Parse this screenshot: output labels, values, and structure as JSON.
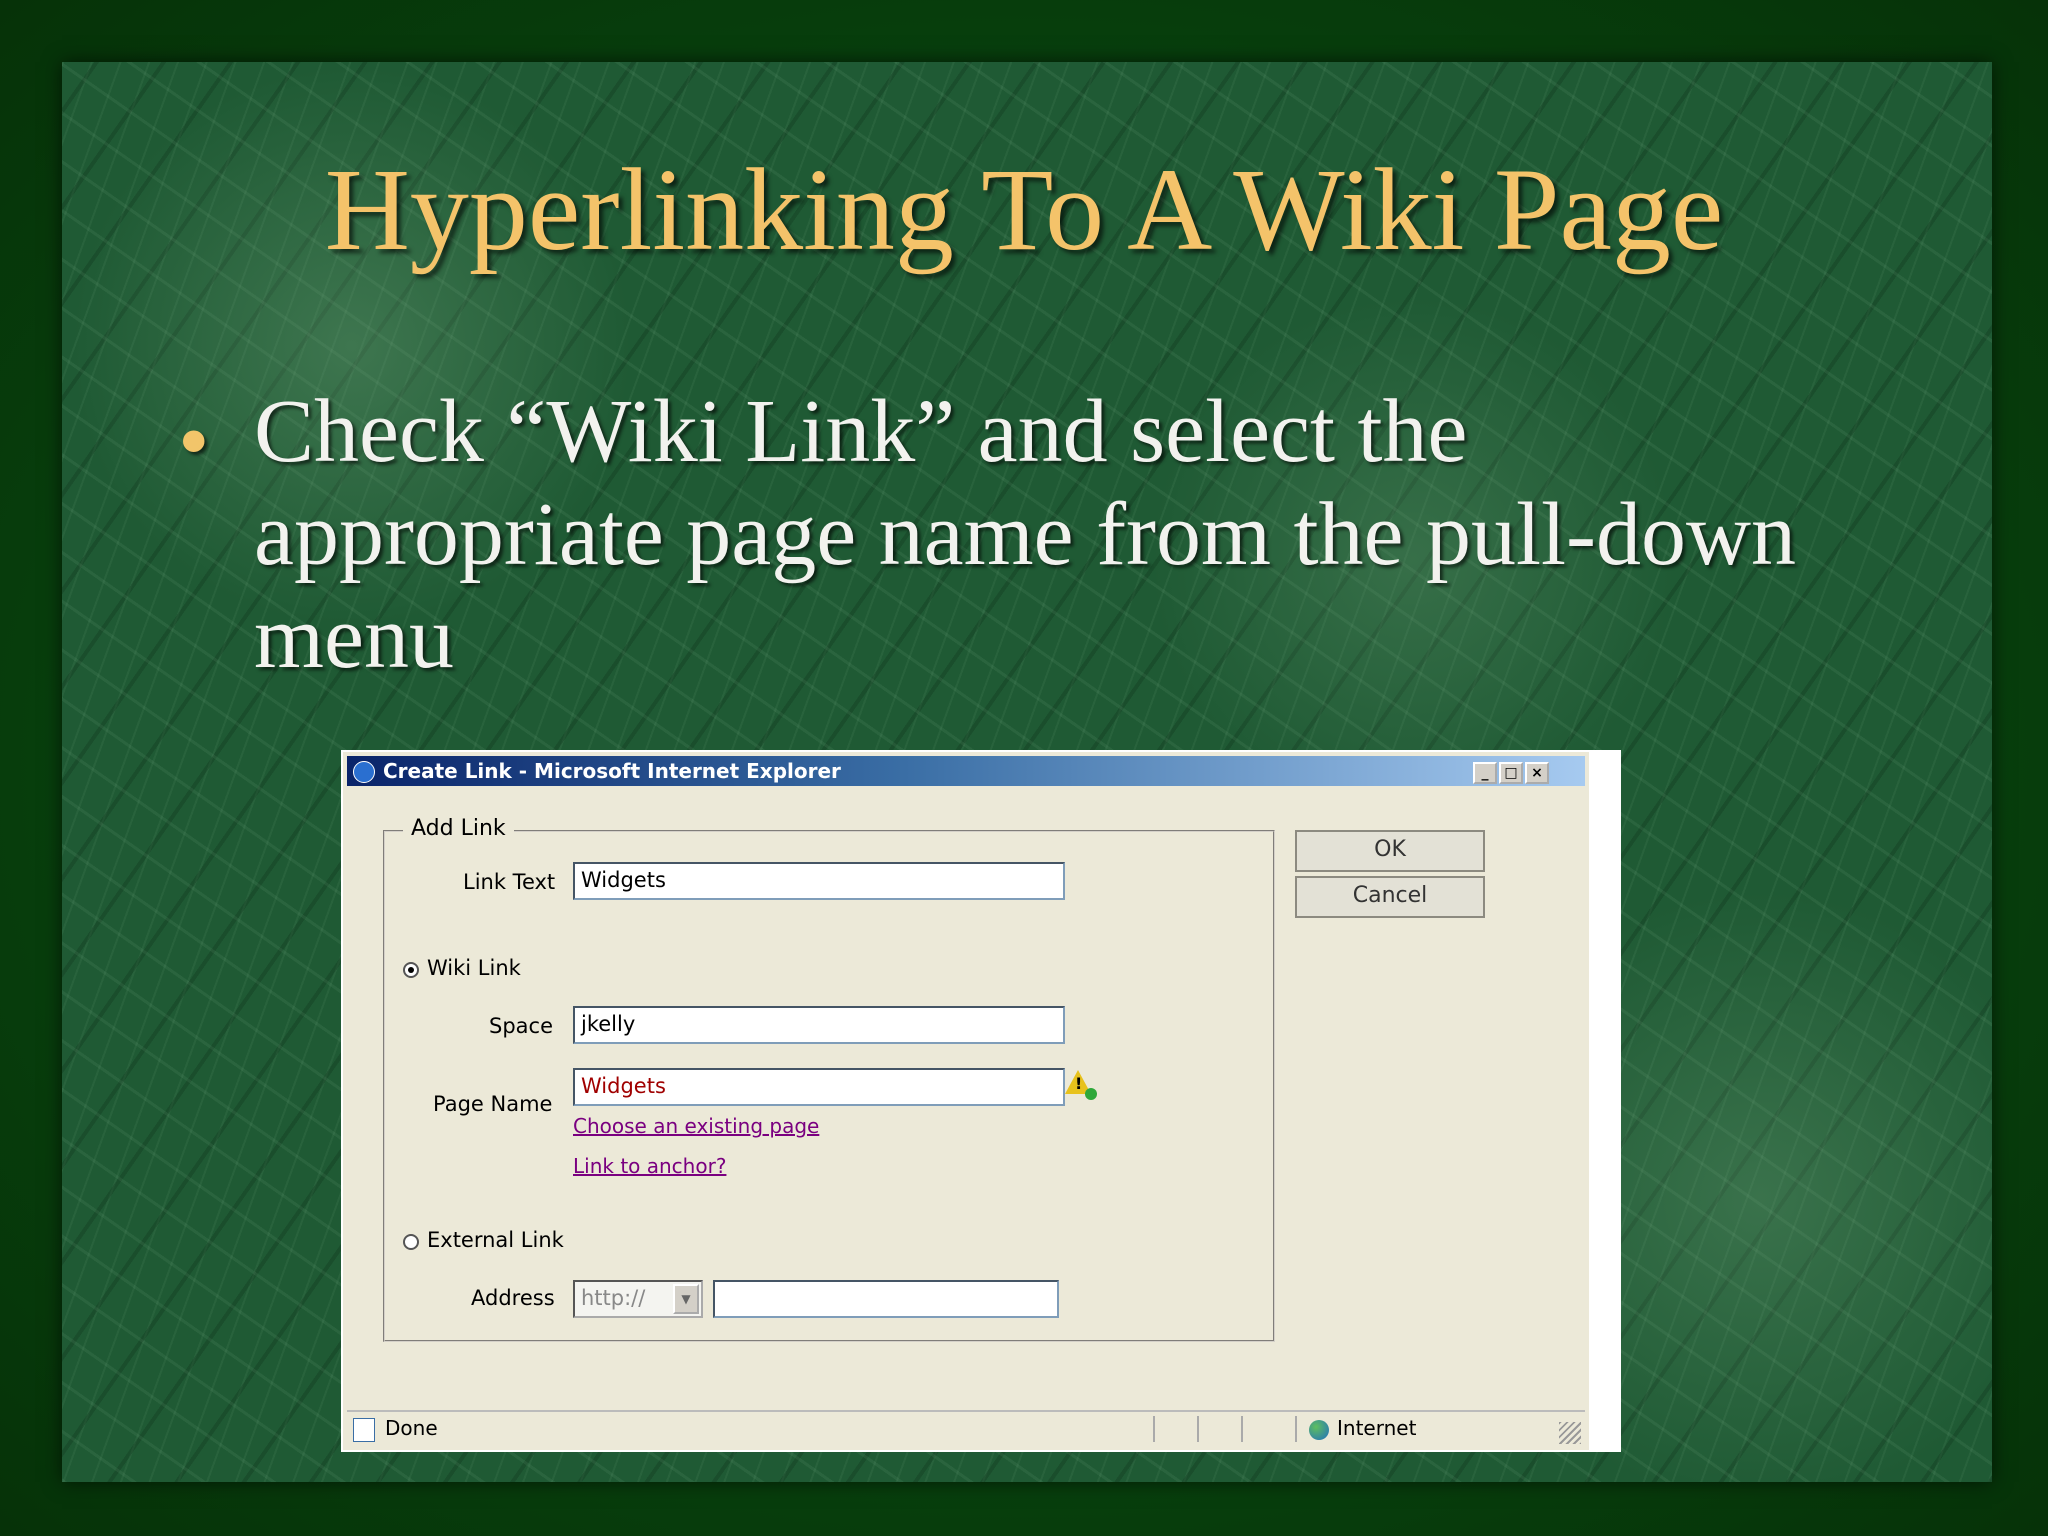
{
  "slide": {
    "title": "Hyperlinking To A Wiki Page",
    "bullet": "•",
    "bullet_text": "Check “Wiki Link” and select the appropriate page name from the pull-down menu"
  },
  "dialog": {
    "window_title": "Create Link - Microsoft Internet Explorer",
    "window_buttons": {
      "minimize": "_",
      "maximize": "□",
      "close": "×"
    },
    "group_label": "Add Link",
    "link_text_label": "Link Text",
    "link_text_value": "Widgets",
    "wiki_link_label": "Wiki Link",
    "wiki_link_checked": true,
    "space_label": "Space",
    "space_value": "jkelly",
    "page_name_label": "Page Name",
    "page_name_value": "Widgets",
    "choose_page_link": "Choose an existing page",
    "link_anchor_link": "Link to anchor?",
    "external_link_label": "External Link",
    "external_link_checked": false,
    "address_label": "Address",
    "address_protocol": "http://",
    "address_value": "",
    "ok_label": "OK",
    "cancel_label": "Cancel",
    "status_text": "Done",
    "zone_text": "Internet"
  },
  "colors": {
    "title": "#f4c36a",
    "bullet_text": "#f2f2ee",
    "link": "#7a0080",
    "page_name_text": "#a00000"
  },
  "icons": [
    "ie-icon",
    "warning-icon",
    "page-icon",
    "globe-icon",
    "resize-grip-icon",
    "dropdown-arrow-icon"
  ]
}
